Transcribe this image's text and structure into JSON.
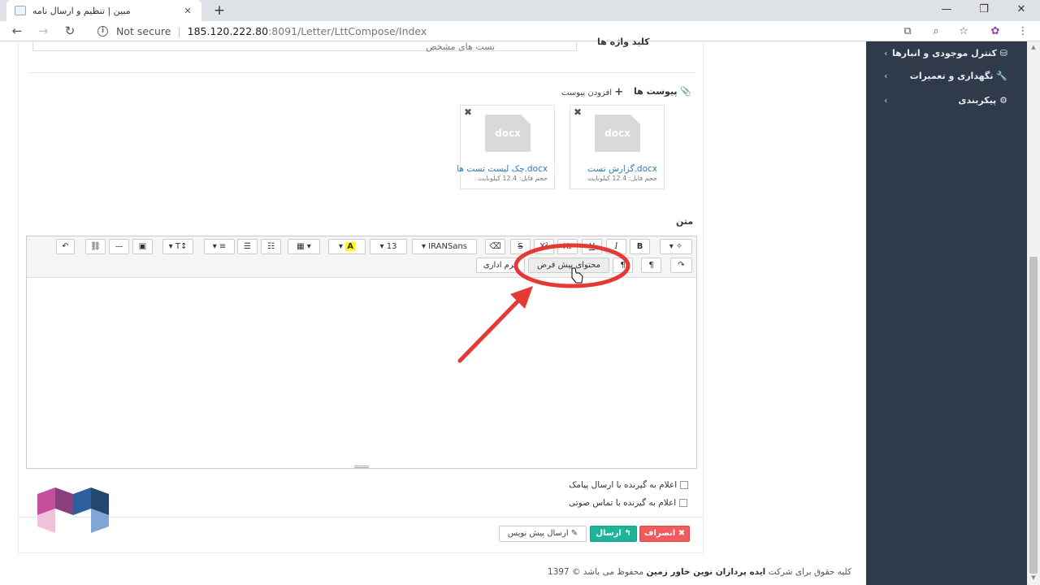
{
  "browser": {
    "tab_title": "مبین | تنظیم و ارسال نامه",
    "tab_close": "✕",
    "new_tab": "+",
    "not_secure": "Not secure",
    "url_host": "185.120.222.80",
    "url_path": ":8091/Letter/LttCompose/Index",
    "window_controls": {
      "minimize": "—",
      "restore": "❐",
      "close": "✕"
    }
  },
  "sidebar": {
    "items": [
      {
        "label": "کنترل موجودی و انبارها",
        "icon": "inventory-icon"
      },
      {
        "label": "نگهداری و تعمیرات",
        "icon": "wrench-icon"
      },
      {
        "label": "پیکربندی",
        "icon": "cogs-icon"
      }
    ]
  },
  "form": {
    "top_field_label": "کلید واژه ها",
    "top_field_value": "تست های مشخص",
    "attachments_label": "پیوست ها",
    "add_attachment": "افزودن پیوست",
    "files": [
      {
        "ext": "docx",
        "name": "گزارش تست.docx",
        "size": "حجم فایل: 12.4 کیلوبایت"
      },
      {
        "ext": "docx",
        "name": "چک لیست تست ها.docx",
        "size": "حجم فایل: 12.4 کیلوبایت"
      }
    ],
    "text_label": "متن",
    "checkbox_sms": "اعلام به گیرنده با ارسال پیامک",
    "checkbox_voice": "اعلام به گیرنده با تماس صوتی"
  },
  "editor": {
    "font_name": "IRANSans",
    "font_size": "13",
    "default_content_button": "محتوای پیش فرض",
    "admin_form_button": "فرم اداری"
  },
  "actions": {
    "cancel": "✖ انصراف",
    "send": "ارسال",
    "draft": "ارسال پیش نویس"
  },
  "footer": {
    "prefix": "کلیه حقوق برای شرکت ",
    "company": "ایده پردازان نوین خاور زمین",
    "suffix": " محفوظ می باشد © 1397"
  },
  "colors": {
    "sidebar_bg": "#2f3b4a",
    "annotation_red": "#e53935",
    "send_green": "#1fb39a",
    "cancel_red": "#f05a5a"
  }
}
